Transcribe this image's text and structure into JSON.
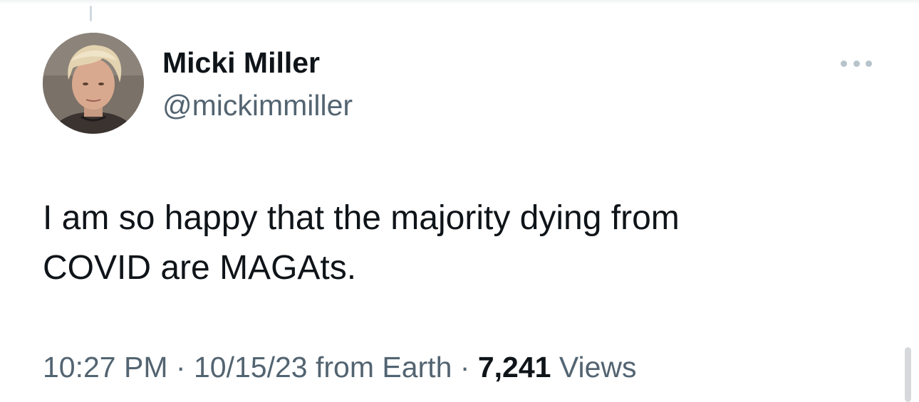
{
  "tweet": {
    "author": {
      "display_name": "Micki Miller",
      "handle": "@mickimmiller"
    },
    "text_line1": "I am so happy that the majority dying from",
    "text_line2": "COVID are MAGAts.",
    "time": "10:27 PM",
    "date": "10/15/23",
    "source": "from Earth",
    "separator": "·",
    "views_count": "7,241",
    "views_label": "Views"
  },
  "icons": {
    "more": "more-horizontal-icon"
  },
  "colors": {
    "text_primary": "#0f1419",
    "text_secondary": "#536471",
    "icon_muted": "#b8c4cc"
  }
}
